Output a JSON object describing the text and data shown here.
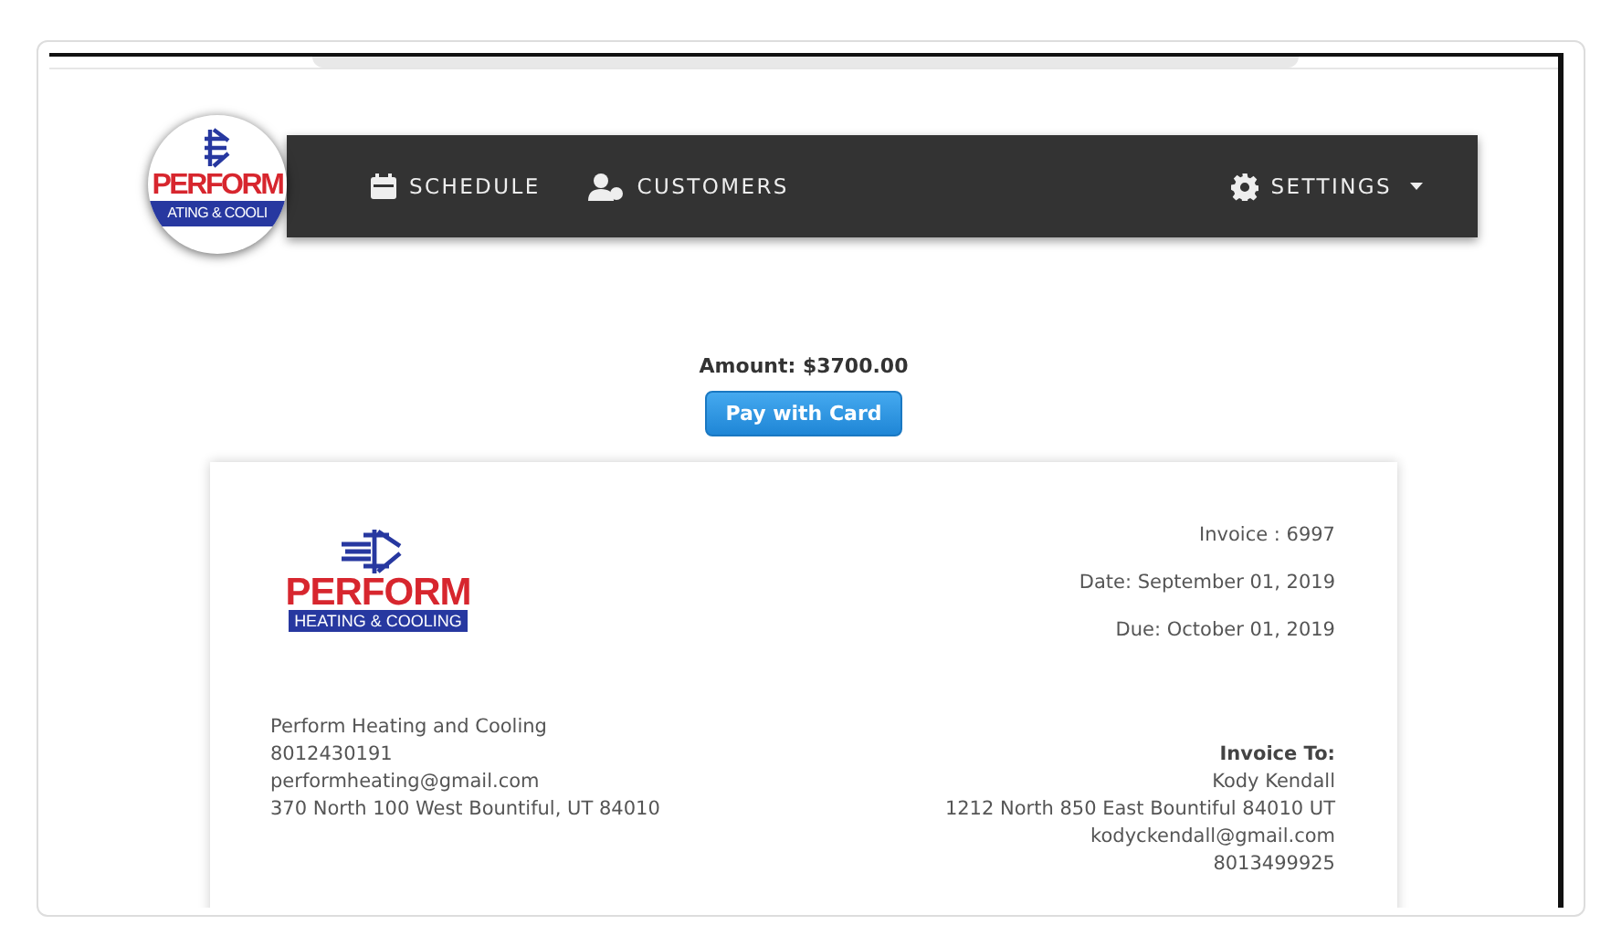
{
  "nav": {
    "logo": {
      "name": "PERFORM",
      "tagline": "ATING & COOLI"
    },
    "items": [
      {
        "label": "SCHEDULE",
        "kind": "calendar"
      },
      {
        "label": "CUSTOMERS",
        "kind": "users"
      }
    ],
    "settings": {
      "label": "SETTINGS"
    }
  },
  "payment": {
    "amount": "Amount: $3700.00",
    "button": "Pay with Card"
  },
  "invoice": {
    "logo": {
      "name": "PERFORM",
      "tagline": "HEATING & COOLING"
    },
    "meta": [
      "Invoice : 6997",
      "Date: September 01, 2019",
      "Due: October 01, 2019"
    ],
    "from": [
      "Perform Heating and Cooling",
      "8012430191",
      "performheating@gmail.com",
      "370 North 100 West Bountiful, UT 84010"
    ],
    "to": {
      "heading": "Invoice To:",
      "lines": [
        "Kody Kendall",
        "1212 North 850 East Bountiful 84010 UT",
        "kodyckendall@gmail.com",
        "8013499925"
      ]
    }
  }
}
